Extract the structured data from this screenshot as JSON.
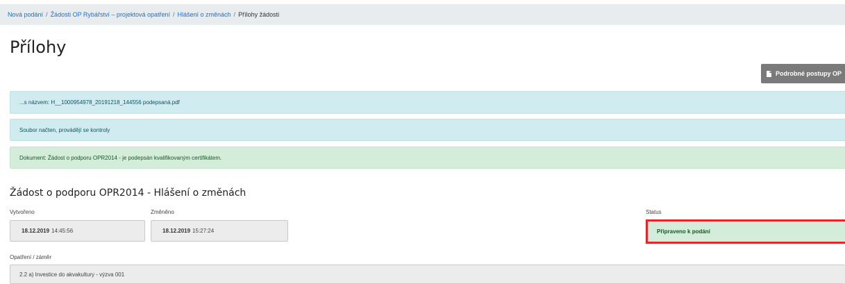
{
  "breadcrumb": {
    "items": [
      "Nová podání",
      "Žádosti OP Rybářství – projektová opatření",
      "Hlášení o změnách"
    ],
    "current": "Přílohy žádosti",
    "separator": "/"
  },
  "page": {
    "title": "Přílohy"
  },
  "guide_button": {
    "label": "Podrobné postupy OP",
    "icon": "document-icon"
  },
  "alerts": [
    {
      "type": "info",
      "text": "...s názvem: H__1000954978_20191218_144556 podepsaná.pdf"
    },
    {
      "type": "info",
      "text": "Soubor načten, provádějí se kontroly"
    },
    {
      "type": "success",
      "text": "Dokument: Žádost o podporu OPR2014 - je podepsán kvalifikovaným certifikátem."
    }
  ],
  "form": {
    "title": "Žádost o podporu OPR2014 - Hlášení o změnách",
    "created": {
      "label": "Vytvořeno",
      "date": "18.12.2019",
      "time": "14:45:56"
    },
    "changed": {
      "label": "Změněno",
      "date": "18.12.2019",
      "time": "15:27:24"
    },
    "status": {
      "label": "Status",
      "value": "Připraveno k podání"
    },
    "measure": {
      "label": "Opatření / záměr",
      "value": "2.2 a) Investice do akvakultury - výzva 001"
    }
  },
  "colors": {
    "link": "#1a73c9",
    "info_bg": "#d1ecf1",
    "success_bg": "#d4edda",
    "highlight_border": "#e3262b",
    "button_bg": "#7a7a7a"
  }
}
